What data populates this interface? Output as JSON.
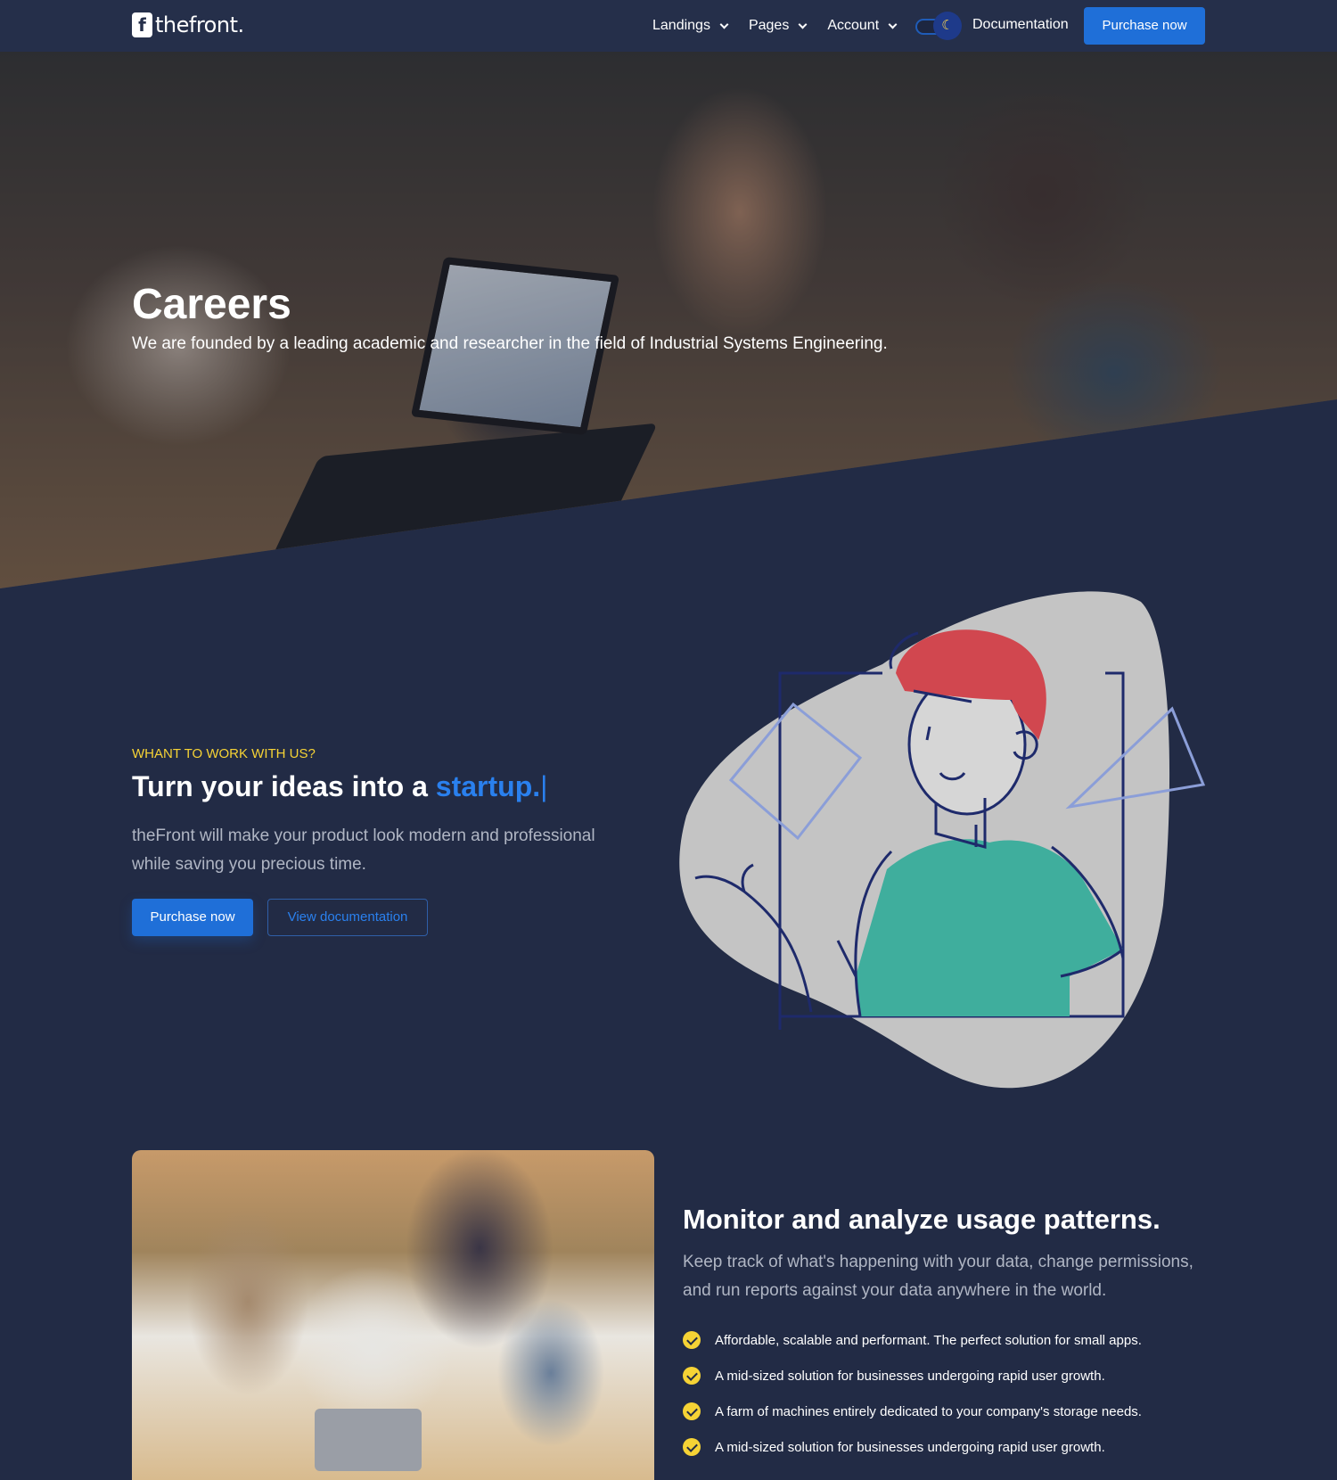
{
  "header": {
    "logo_letter": "f",
    "logo_text": "thefront.",
    "nav": [
      {
        "label": "Landings"
      },
      {
        "label": "Pages"
      },
      {
        "label": "Account"
      }
    ],
    "theme_toggle_icon": "moon-icon",
    "documentation_label": "Documentation",
    "purchase_label": "Purchase now"
  },
  "hero": {
    "title": "Careers",
    "subtitle": "We are founded by a leading academic and researcher in the field of Industrial Systems Engineering."
  },
  "intro": {
    "eyebrow": "WHANT TO WORK WITH US?",
    "headline_prefix": "Turn your ideas into a",
    "headline_accent": "startup.",
    "caret": "|",
    "description": "theFront will make your product look modern and professional while saving you precious time.",
    "primary_button": "Purchase now",
    "secondary_button": "View documentation"
  },
  "usage": {
    "title": "Monitor and analyze usage patterns.",
    "description": "Keep track of what's happening with your data, change permissions, and run reports against your data anywhere in the world.",
    "features": [
      "Affordable, scalable and performant. The perfect solution for small apps.",
      "A mid-sized solution for businesses undergoing rapid user growth.",
      "A farm of machines entirely dedicated to your company's storage needs.",
      "A mid-sized solution for businesses undergoing rapid user growth."
    ]
  },
  "colors": {
    "background": "#222b45",
    "header": "#252f4a",
    "primary": "#1f6fd8",
    "accent_text": "#2a80ee",
    "eyebrow": "#f6d335",
    "check": "#f6d335",
    "illustration_hair": "#d1474f",
    "illustration_shirt": "#3fae9d"
  }
}
